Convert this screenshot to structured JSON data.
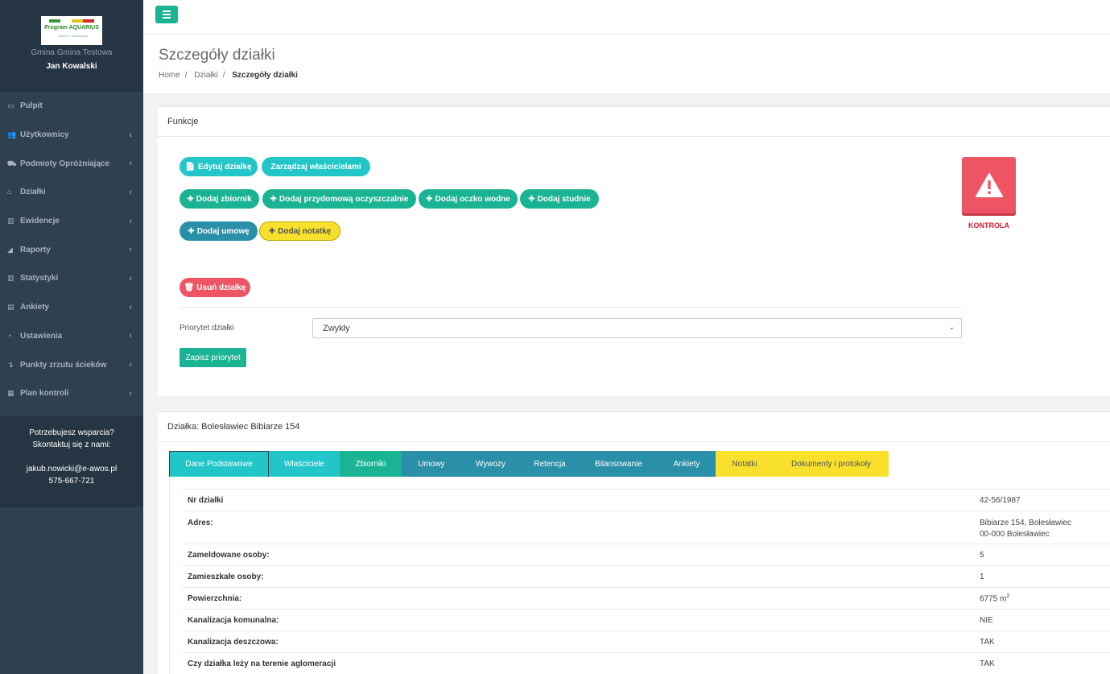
{
  "sidebar": {
    "logo": {
      "brand": "Program AQUARIUS",
      "tagline": "...dbamy o środowisko"
    },
    "gmina": "Gmina Gmina Testowa",
    "user": "Jan Kowalski",
    "items": [
      {
        "label": "Pulpit",
        "icon": "monitor-icon",
        "has_children": false
      },
      {
        "label": "Użytkownicy",
        "icon": "users-icon",
        "has_children": true
      },
      {
        "label": "Podmioty Opróżniające",
        "icon": "truck-icon",
        "has_children": true
      },
      {
        "label": "Działki",
        "icon": "home-icon",
        "has_children": true
      },
      {
        "label": "Ewidencje",
        "icon": "bar-chart-icon",
        "has_children": true
      },
      {
        "label": "Raporty",
        "icon": "area-chart-icon",
        "has_children": true
      },
      {
        "label": "Statystyki",
        "icon": "bar-chart-icon",
        "has_children": true
      },
      {
        "label": "Ankiety",
        "icon": "file-icon",
        "has_children": true
      },
      {
        "label": "Ustawienia",
        "icon": "dashboard-icon",
        "has_children": true
      },
      {
        "label": "Punkty zrzutu ścieków",
        "icon": "level-down-icon",
        "has_children": true
      },
      {
        "label": "Plan kontroli",
        "icon": "calendar-icon",
        "has_children": true
      }
    ],
    "support": {
      "line1": "Potrzebujesz wsparcia?",
      "line2": "Skontaktuj się z nami:",
      "email": "jakub.nowicki@e-awos.pl",
      "phone": "575-667-721"
    }
  },
  "header": {
    "title": "Szczegóły działki",
    "breadcrumb": [
      "Home",
      "Działki",
      "Szczegóły działki"
    ]
  },
  "functions": {
    "title": "Funkcje",
    "edit": "Edytuj działkę",
    "owners": "Zarządzaj właścicielami",
    "add_tank": "Dodaj zbiornik",
    "add_plant": "Dodaj przydomową oczyszczalnie",
    "add_pond": "Dodaj oczko wodne",
    "add_well": "Dodaj studnie",
    "add_contract": "Dodaj umowę",
    "add_note": "Dodaj notatkę",
    "delete": "Usuń działkę",
    "control_label": "KONTROLA",
    "priority_label": "Priorytet działki",
    "priority_value": "Zwykły",
    "save_priority": "Zapisz priorytet"
  },
  "parcel": {
    "title": "Działka: Bolesławiec Bibiarze 154",
    "tabs": [
      {
        "label": "Dane Podstawowe",
        "color": "#23c6c8"
      },
      {
        "label": "Właściciele",
        "color": "#23c6c8"
      },
      {
        "label": "Zbiorniki",
        "color": "#1ab394"
      },
      {
        "label": "Umowy",
        "color": "#2a8fa8"
      },
      {
        "label": "Wywozy",
        "color": "#2a8fa8"
      },
      {
        "label": "Retencja",
        "color": "#2a8fa8"
      },
      {
        "label": "Bilansowanie",
        "color": "#2a8fa8"
      },
      {
        "label": "Ankiety",
        "color": "#2a8fa8"
      },
      {
        "label": "Notatki",
        "color": "#f8e02d"
      },
      {
        "label": "Dokumenty i protokoły",
        "color": "#f8e02d"
      }
    ],
    "rows": [
      {
        "key": "Nr działki",
        "value": "42-56/1987"
      },
      {
        "key": "Adres:",
        "value": "Bibiarze 154, Bolesławiec",
        "value2": "00-000 Bolesławiec"
      },
      {
        "key": "Zameldowane osoby:",
        "value": "5"
      },
      {
        "key": "Zamieszkałe osoby:",
        "value": "1"
      },
      {
        "key": "Powierzchnia:",
        "value": "6775 m",
        "sup": "2"
      },
      {
        "key": "Kanalizacja komunalna:",
        "value": "NIE"
      },
      {
        "key": "Kanalizacja deszczowa:",
        "value": "TAK"
      },
      {
        "key": "Czy działka leży na terenie aglomeracji",
        "value": "TAK"
      }
    ]
  },
  "colors": {
    "sidebar": "#2f4050",
    "accent": "#1ab394",
    "danger": "#ed5565"
  }
}
